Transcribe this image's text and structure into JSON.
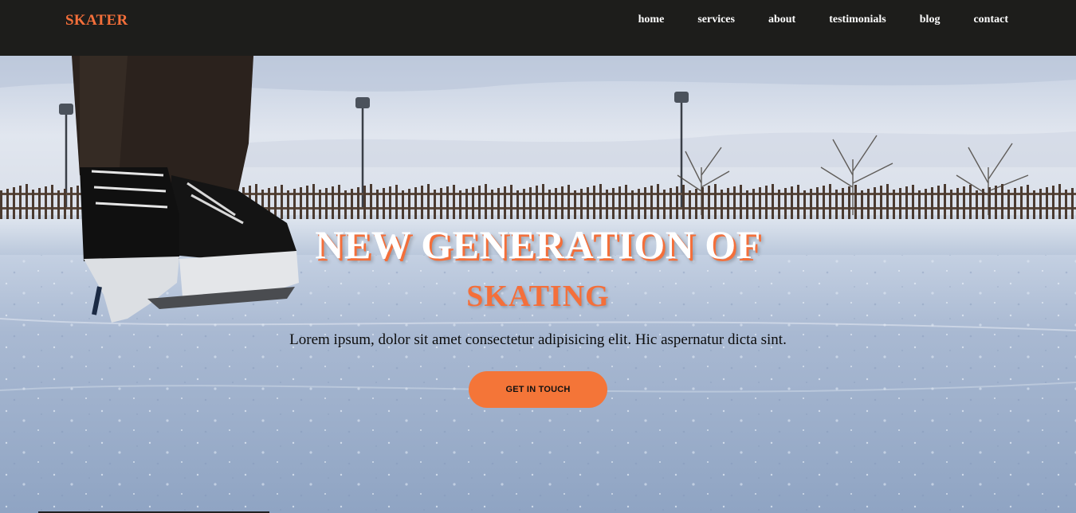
{
  "brand": {
    "name": "SKATER",
    "accent_color": "#f46f3a"
  },
  "nav": {
    "items": [
      {
        "label": "home"
      },
      {
        "label": "services"
      },
      {
        "label": "about"
      },
      {
        "label": "testimonials"
      },
      {
        "label": "blog"
      },
      {
        "label": "contact"
      }
    ]
  },
  "hero": {
    "title": "NEW GENERATION OF",
    "subtitle": "SKATING",
    "text": "Lorem ipsum, dolor sit amet consectetur adipisicing elit. Hic aspernatur dicta sint.",
    "cta_label": "GET IN TOUCH",
    "background_image": "ice-rink-skate-photo"
  }
}
